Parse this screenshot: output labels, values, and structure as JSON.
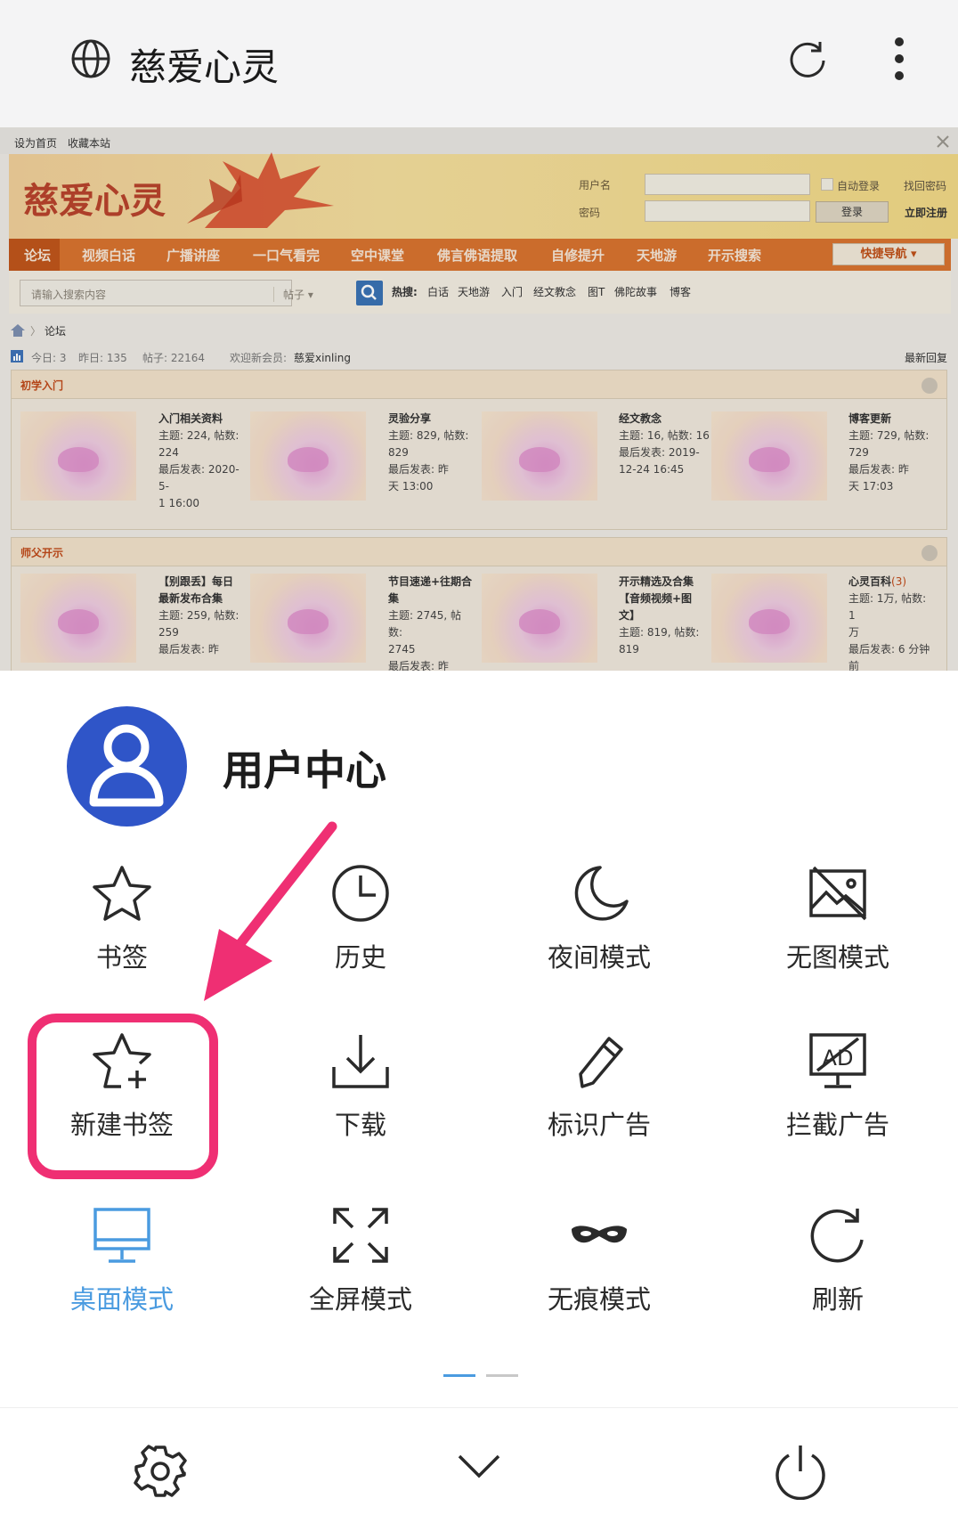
{
  "browser": {
    "title": "慈爱心灵"
  },
  "web": {
    "top_links": [
      "设为首页",
      "收藏本站"
    ],
    "logo": "慈爱心灵",
    "login": {
      "username_label": "用户名",
      "password_label": "密码",
      "auto_login": "自动登录",
      "forgot": "找回密码",
      "login_btn": "登录",
      "register": "立即注册"
    },
    "nav": [
      "论坛",
      "视频白话",
      "广播讲座",
      "一口气看完",
      "空中课堂",
      "佛言佛语提取",
      "自修提升",
      "天地游",
      "开示搜索"
    ],
    "quick_nav": "快捷导航",
    "search": {
      "placeholder": "请输入搜索内容",
      "scope": "帖子",
      "hot_label": "热搜:",
      "hot": [
        "白话",
        "天地游",
        "入门",
        "经文教念",
        "图T",
        "佛陀故事",
        "博客"
      ]
    },
    "crumb": "论坛",
    "stats": {
      "today": "今日: 3",
      "yesterday": "昨日: 135",
      "posts": "帖子: 22164",
      "welcome": "欢迎新会员:",
      "member": "慈爱xinling",
      "latest": "最新回复"
    },
    "sections": [
      {
        "title": "初学入门",
        "forums": [
          {
            "name": "入门相关资料",
            "info": "主题: 224, 帖数:\n224\n最后发表: 2020-5-\n1 16:00"
          },
          {
            "name": "灵验分享",
            "info": "主题: 829, 帖数:\n829\n最后发表: 昨\n天 13:00"
          },
          {
            "name": "经文教念",
            "info": "主题: 16, 帖数: 16\n最后发表: 2019-\n12-24 16:45"
          },
          {
            "name": "博客更新",
            "info": "主题: 729, 帖数:\n729\n最后发表: 昨\n天 17:03"
          }
        ]
      },
      {
        "title": "师父开示",
        "forums": [
          {
            "name": "【别跟丢】每日\n最新发布合集",
            "info": "主题: 259, 帖数:\n259\n最后发表: 昨"
          },
          {
            "name": "节目速递+往期合\n集",
            "info": "主题: 2745, 帖数:\n2745\n最后发表: 昨"
          },
          {
            "name": "开示精选及合集\n【音频视频+图\n文】",
            "info": "主题: 819, 帖数:\n819"
          },
          {
            "name": "心灵百科",
            "badge": "(3)",
            "info": "主题: 1万, 帖数: 1\n万\n最后发表: 6 分钟\n前"
          }
        ]
      }
    ]
  },
  "menu": {
    "title": "用户中心",
    "items": [
      {
        "label": "书签",
        "icon": "star-icon"
      },
      {
        "label": "历史",
        "icon": "clock-icon"
      },
      {
        "label": "夜间模式",
        "icon": "moon-icon"
      },
      {
        "label": "无图模式",
        "icon": "no-image-icon"
      },
      {
        "label": "新建书签",
        "icon": "star-plus-icon"
      },
      {
        "label": "下载",
        "icon": "download-icon"
      },
      {
        "label": "标识广告",
        "icon": "pencil-icon"
      },
      {
        "label": "拦截广告",
        "icon": "ad-block-icon"
      },
      {
        "label": "桌面模式",
        "icon": "desktop-icon",
        "active": true
      },
      {
        "label": "全屏模式",
        "icon": "fullscreen-icon"
      },
      {
        "label": "无痕模式",
        "icon": "incognito-mask-icon"
      },
      {
        "label": "刷新",
        "icon": "refresh-icon"
      }
    ],
    "pages": 2,
    "current_page": 1
  },
  "bottom": {
    "icons": [
      "settings-gear-icon",
      "collapse-chevron-icon",
      "power-exit-icon"
    ]
  },
  "colors": {
    "accent": "#4a9be0",
    "avatar": "#2f55c8",
    "highlight": "#ef2f73",
    "nav": "#d8732f"
  }
}
